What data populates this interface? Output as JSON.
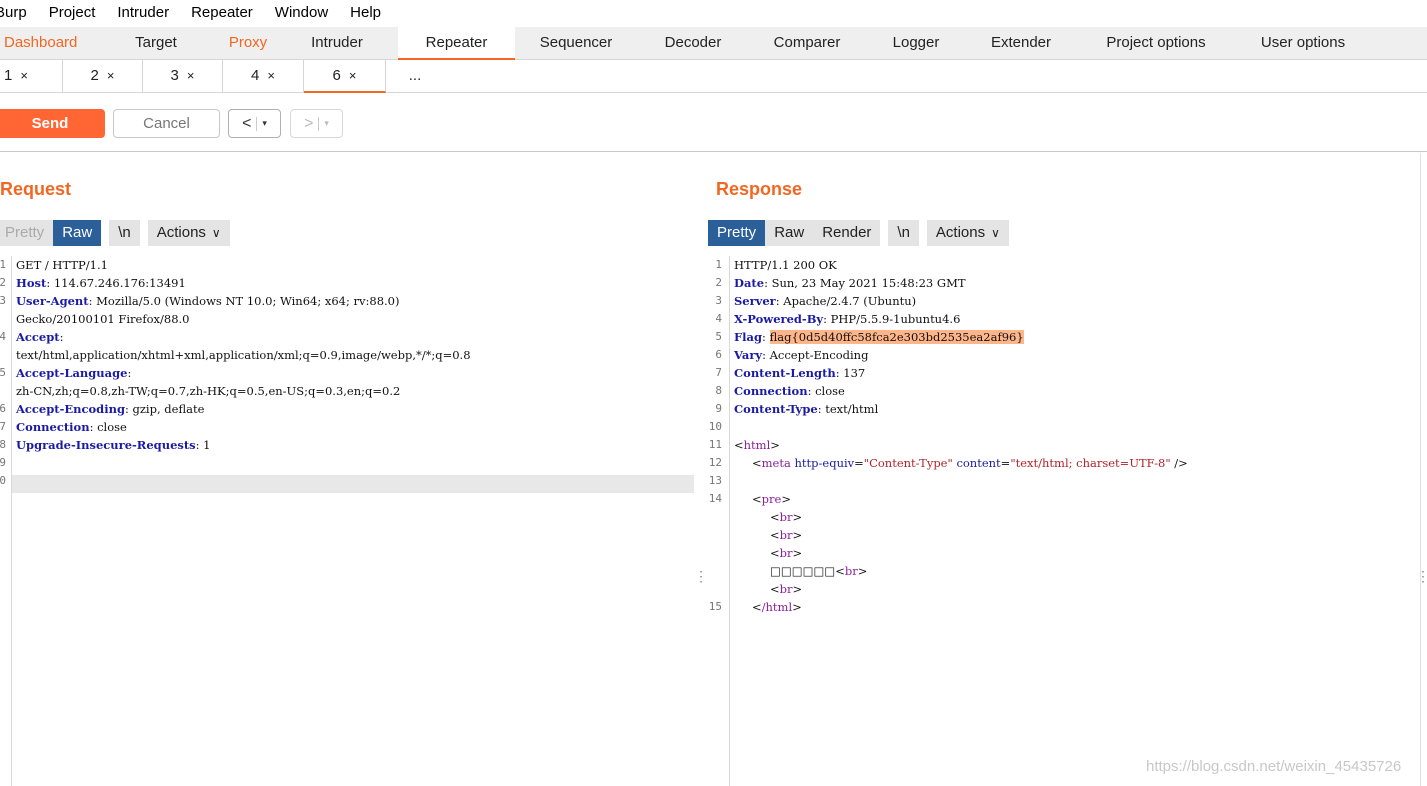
{
  "menu": [
    "Burp",
    "Project",
    "Intruder",
    "Repeater",
    "Window",
    "Help"
  ],
  "tabs": [
    "Dashboard",
    "Target",
    "Proxy",
    "Intruder",
    "Repeater",
    "Sequencer",
    "Decoder",
    "Comparer",
    "Logger",
    "Extender",
    "Project options",
    "User options"
  ],
  "subtabs": [
    "1",
    "2",
    "3",
    "4",
    "6",
    "..."
  ],
  "subtab_close": "×",
  "toolbar": {
    "send": "Send",
    "cancel": "Cancel",
    "prev": "<",
    "next": ">",
    "dropdown": "▾"
  },
  "request": {
    "title": "Request",
    "views": {
      "pretty": "Pretty",
      "raw": "Raw",
      "newline": "\\n",
      "actions": "Actions"
    },
    "line_numbers": [
      "1",
      "2",
      "3",
      "",
      "4",
      "",
      "5",
      "",
      "6",
      "7",
      "8",
      "9",
      "0"
    ],
    "lines": [
      {
        "k": "",
        "v": "GET / HTTP/1.1"
      },
      {
        "k": "Host",
        "v": ": 114.67.246.176:13491"
      },
      {
        "k": "User-Agent",
        "v": ": Mozilla/5.0 (Windows NT 10.0; Win64; x64; rv:88.0)"
      },
      {
        "k": "",
        "v": "Gecko/20100101 Firefox/88.0"
      },
      {
        "k": "Accept",
        "v": ":"
      },
      {
        "k": "",
        "v": "text/html,application/xhtml+xml,application/xml;q=0.9,image/webp,*/*;q=0.8"
      },
      {
        "k": "Accept-Language",
        "v": ":"
      },
      {
        "k": "",
        "v": "zh-CN,zh;q=0.8,zh-TW;q=0.7,zh-HK;q=0.5,en-US;q=0.3,en;q=0.2"
      },
      {
        "k": "Accept-Encoding",
        "v": ": gzip, deflate"
      },
      {
        "k": "Connection",
        "v": ": close"
      },
      {
        "k": "Upgrade-Insecure-Requests",
        "v": ": 1"
      },
      {
        "k": "",
        "v": ""
      },
      {
        "k": "",
        "v": ""
      }
    ]
  },
  "response": {
    "title": "Response",
    "views": {
      "pretty": "Pretty",
      "raw": "Raw",
      "render": "Render",
      "newline": "\\n",
      "actions": "Actions"
    },
    "line_numbers": [
      "1",
      "2",
      "3",
      "4",
      "5",
      "6",
      "7",
      "8",
      "9",
      "10",
      "11",
      "12",
      "13",
      "14",
      "",
      "",
      "",
      "",
      "",
      "15"
    ],
    "status_line": "HTTP/1.1 200 OK",
    "headers": [
      {
        "k": "Date",
        "v": ": Sun, 23 May 2021 15:48:23 GMT"
      },
      {
        "k": "Server",
        "v": ": Apache/2.4.7 (Ubuntu)"
      },
      {
        "k": "X-Powered-By",
        "v": ": PHP/5.5.9-1ubuntu4.6"
      },
      {
        "k": "Flag",
        "v": ": "
      },
      {
        "k": "Vary",
        "v": ": Accept-Encoding"
      },
      {
        "k": "Content-Length",
        "v": ": 137"
      },
      {
        "k": "Connection",
        "v": ": close"
      },
      {
        "k": "Content-Type",
        "v": ": text/html"
      }
    ],
    "flag_value": "flag{0d5d40ffc58fca2e303bd2535ea2af96}",
    "html_open": "html",
    "meta_tag": "meta",
    "meta_attr1": "http-equiv",
    "meta_val1": "\"Content-Type\"",
    "meta_attr2": "content",
    "meta_val2": "\"text/html; charset=UTF-8\"",
    "meta_close": " />",
    "pre_tag": "pre",
    "br_tag": "br",
    "garbled_text": "□□□□□□",
    "html_close": "/html"
  },
  "watermark": "https://blog.csdn.net/weixin_45435726"
}
